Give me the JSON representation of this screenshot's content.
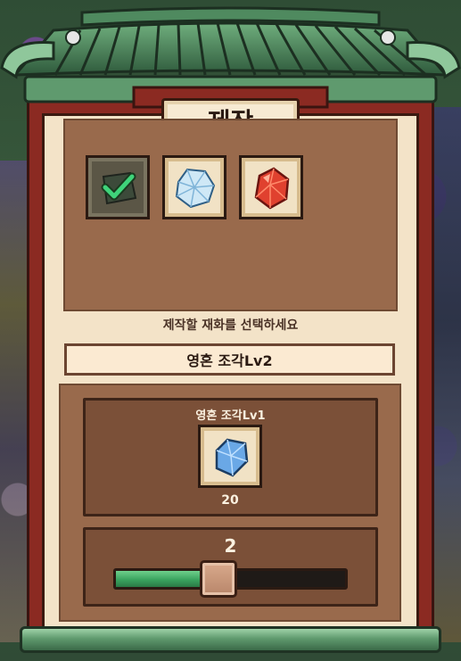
{
  "window": {
    "title": "제작"
  },
  "materials": {
    "slots": [
      {
        "icon": "check-icon",
        "selected": true
      },
      {
        "icon": "diamond-ore-icon",
        "selected": false
      },
      {
        "icon": "red-crystal-icon",
        "selected": false
      }
    ]
  },
  "instruction": "제작할 재화를 선택하세요",
  "result": {
    "name": "영혼 조각Lv2"
  },
  "requirement": {
    "name": "영혼 조각Lv1",
    "icon": "blue-crystal-icon",
    "count": "20"
  },
  "quantity": {
    "value": "2",
    "slider_fraction": 0.45
  },
  "colors": {
    "frame": "#8b2a22",
    "roof": "#3b6a48",
    "panel": "#996a4c",
    "slider_fill": "#3aa35f"
  }
}
